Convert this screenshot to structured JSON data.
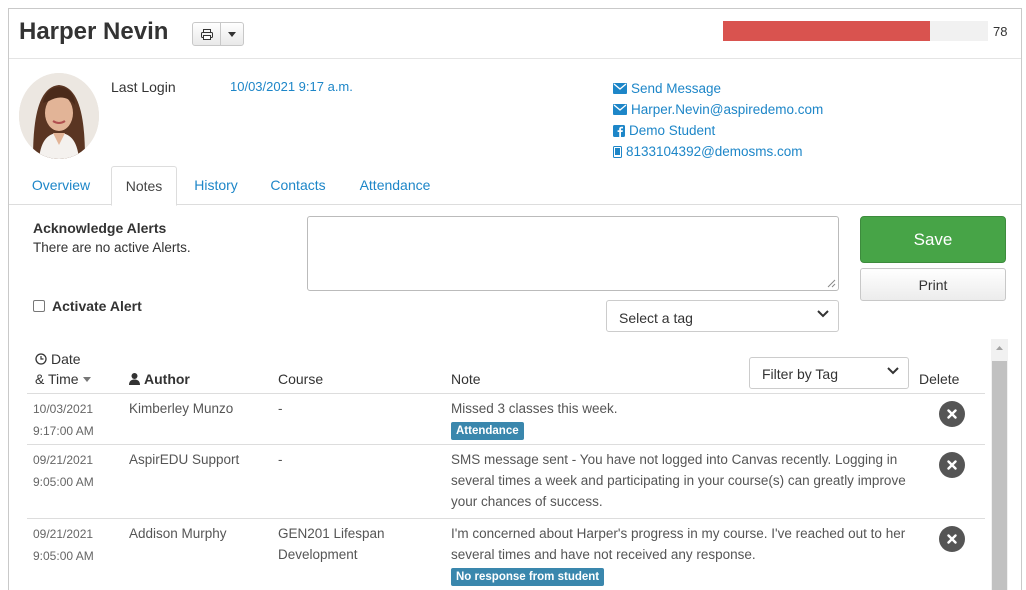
{
  "student": {
    "name": "Harper Nevin"
  },
  "progress": {
    "value": 78,
    "label": "78",
    "fill_percent": 78,
    "color": "#d9534f"
  },
  "last_login": {
    "label": "Last Login",
    "value": "10/03/2021 9:17 a.m."
  },
  "contacts": {
    "send_message": "Send Message",
    "email": "Harper.Nevin@aspiredemo.com",
    "facebook": "Demo Student",
    "sms": "8133104392@demosms.com"
  },
  "tabs": [
    {
      "label": "Overview"
    },
    {
      "label": "Notes",
      "active": true
    },
    {
      "label": "History"
    },
    {
      "label": "Contacts"
    },
    {
      "label": "Attendance"
    }
  ],
  "alerts": {
    "title": "Acknowledge Alerts",
    "message": "There are no active Alerts.",
    "activate_label": "Activate Alert"
  },
  "form": {
    "note_value": "",
    "save_label": "Save",
    "print_label": "Print",
    "tag_select": "Select a tag"
  },
  "table": {
    "headers": {
      "date_line1": "Date",
      "date_line2": "& Time",
      "author": "Author",
      "course": "Course",
      "note": "Note",
      "filter": "Filter by Tag",
      "delete": "Delete"
    },
    "rows": [
      {
        "date": "10/03/2021",
        "time": "9:17:00 AM",
        "author": "Kimberley Munzo",
        "course": "-",
        "note": "Missed 3 classes this week.",
        "tag": "Attendance"
      },
      {
        "date": "09/21/2021",
        "time": "9:05:00 AM",
        "author": "AspirEDU Support",
        "course": "-",
        "note": "SMS message sent - You have not logged into Canvas recently. Logging in several times a week and participating in your course(s) can greatly improve your chances of success.",
        "tag": ""
      },
      {
        "date": "09/21/2021",
        "time": "9:05:00 AM",
        "author": "Addison Murphy",
        "course": "GEN201 Lifespan Development",
        "note": "I'm concerned about Harper's progress in my course. I've reached out to her several times and have not received any response.",
        "tag": "No response from student"
      }
    ]
  },
  "colors": {
    "link": "#1d86c8",
    "save": "#47a447",
    "badge": "#3a87ad",
    "progress_red": "#d9534f"
  }
}
